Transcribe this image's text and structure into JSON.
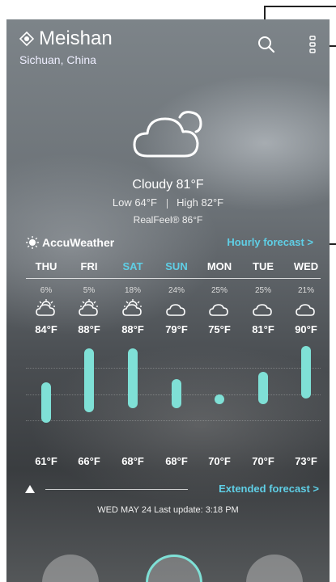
{
  "location": {
    "city": "Meishan",
    "region": "Sichuan, China"
  },
  "current": {
    "condition_temp": "Cloudy 81°F",
    "low": "Low 64°F",
    "high": "High 82°F",
    "realfeel": "RealFeel® 86°F"
  },
  "provider": {
    "name": "AccuWeather",
    "hourly_link": "Hourly forecast >"
  },
  "forecast": [
    {
      "day": "THU",
      "pct": "6%",
      "high": "84°F",
      "low": "61°F",
      "icon": "partly-cloudy-sun-icon",
      "weekend": false,
      "bar": [
        0.22,
        0.62
      ]
    },
    {
      "day": "FRI",
      "pct": "5%",
      "high": "88°F",
      "low": "66°F",
      "icon": "partly-cloudy-sun-icon",
      "weekend": false,
      "bar": [
        0.32,
        0.95
      ]
    },
    {
      "day": "SAT",
      "pct": "18%",
      "high": "88°F",
      "low": "68°F",
      "icon": "partly-cloudy-sun-icon",
      "weekend": true,
      "bar": [
        0.36,
        0.95
      ]
    },
    {
      "day": "SUN",
      "pct": "24%",
      "high": "79°F",
      "low": "68°F",
      "icon": "cloud-icon",
      "weekend": true,
      "bar": [
        0.36,
        0.65
      ]
    },
    {
      "day": "MON",
      "pct": "25%",
      "high": "75°F",
      "low": "70°F",
      "icon": "cloud-icon",
      "weekend": false,
      "bar": [
        0.4,
        0.5
      ]
    },
    {
      "day": "TUE",
      "pct": "25%",
      "high": "81°F",
      "low": "70°F",
      "icon": "cloud-icon",
      "weekend": false,
      "bar": [
        0.4,
        0.72
      ]
    },
    {
      "day": "WED",
      "pct": "21%",
      "high": "90°F",
      "low": "73°F",
      "icon": "cloud-icon",
      "weekend": false,
      "bar": [
        0.46,
        0.98
      ]
    }
  ],
  "extended": {
    "link": "Extended forecast >"
  },
  "last_update": "WED MAY 24 Last update: 3:18 PM",
  "colors": {
    "accent": "#5fcfe6",
    "weekend": "#5fcfe6",
    "bar": "#7fe0d6"
  }
}
